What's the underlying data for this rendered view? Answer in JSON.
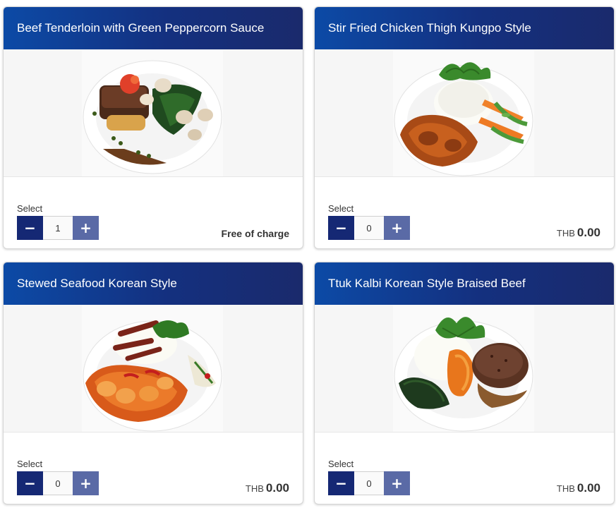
{
  "cards": [
    {
      "title": "Beef Tenderloin with Green Peppercorn Sauce",
      "select_label": "Select",
      "quantity": "1",
      "price_text": "Free of charge",
      "currency": "",
      "amount": ""
    },
    {
      "title": "Stir Fried Chicken Thigh Kungpo Style",
      "select_label": "Select",
      "quantity": "0",
      "price_text": "",
      "currency": "THB",
      "amount": "0.00"
    },
    {
      "title": "Stewed Seafood Korean Style",
      "select_label": "Select",
      "quantity": "0",
      "price_text": "",
      "currency": "THB",
      "amount": "0.00"
    },
    {
      "title": "Ttuk Kalbi Korean Style Braised Beef",
      "select_label": "Select",
      "quantity": "0",
      "price_text": "",
      "currency": "THB",
      "amount": "0.00"
    }
  ],
  "controls": {
    "minus_icon": "minus-icon",
    "plus_icon": "plus-icon"
  },
  "colors": {
    "header_start": "#0c4aa6",
    "header_end": "#1a2a6c",
    "minus_button": "#152874",
    "plus_button": "#5a6aa6"
  }
}
